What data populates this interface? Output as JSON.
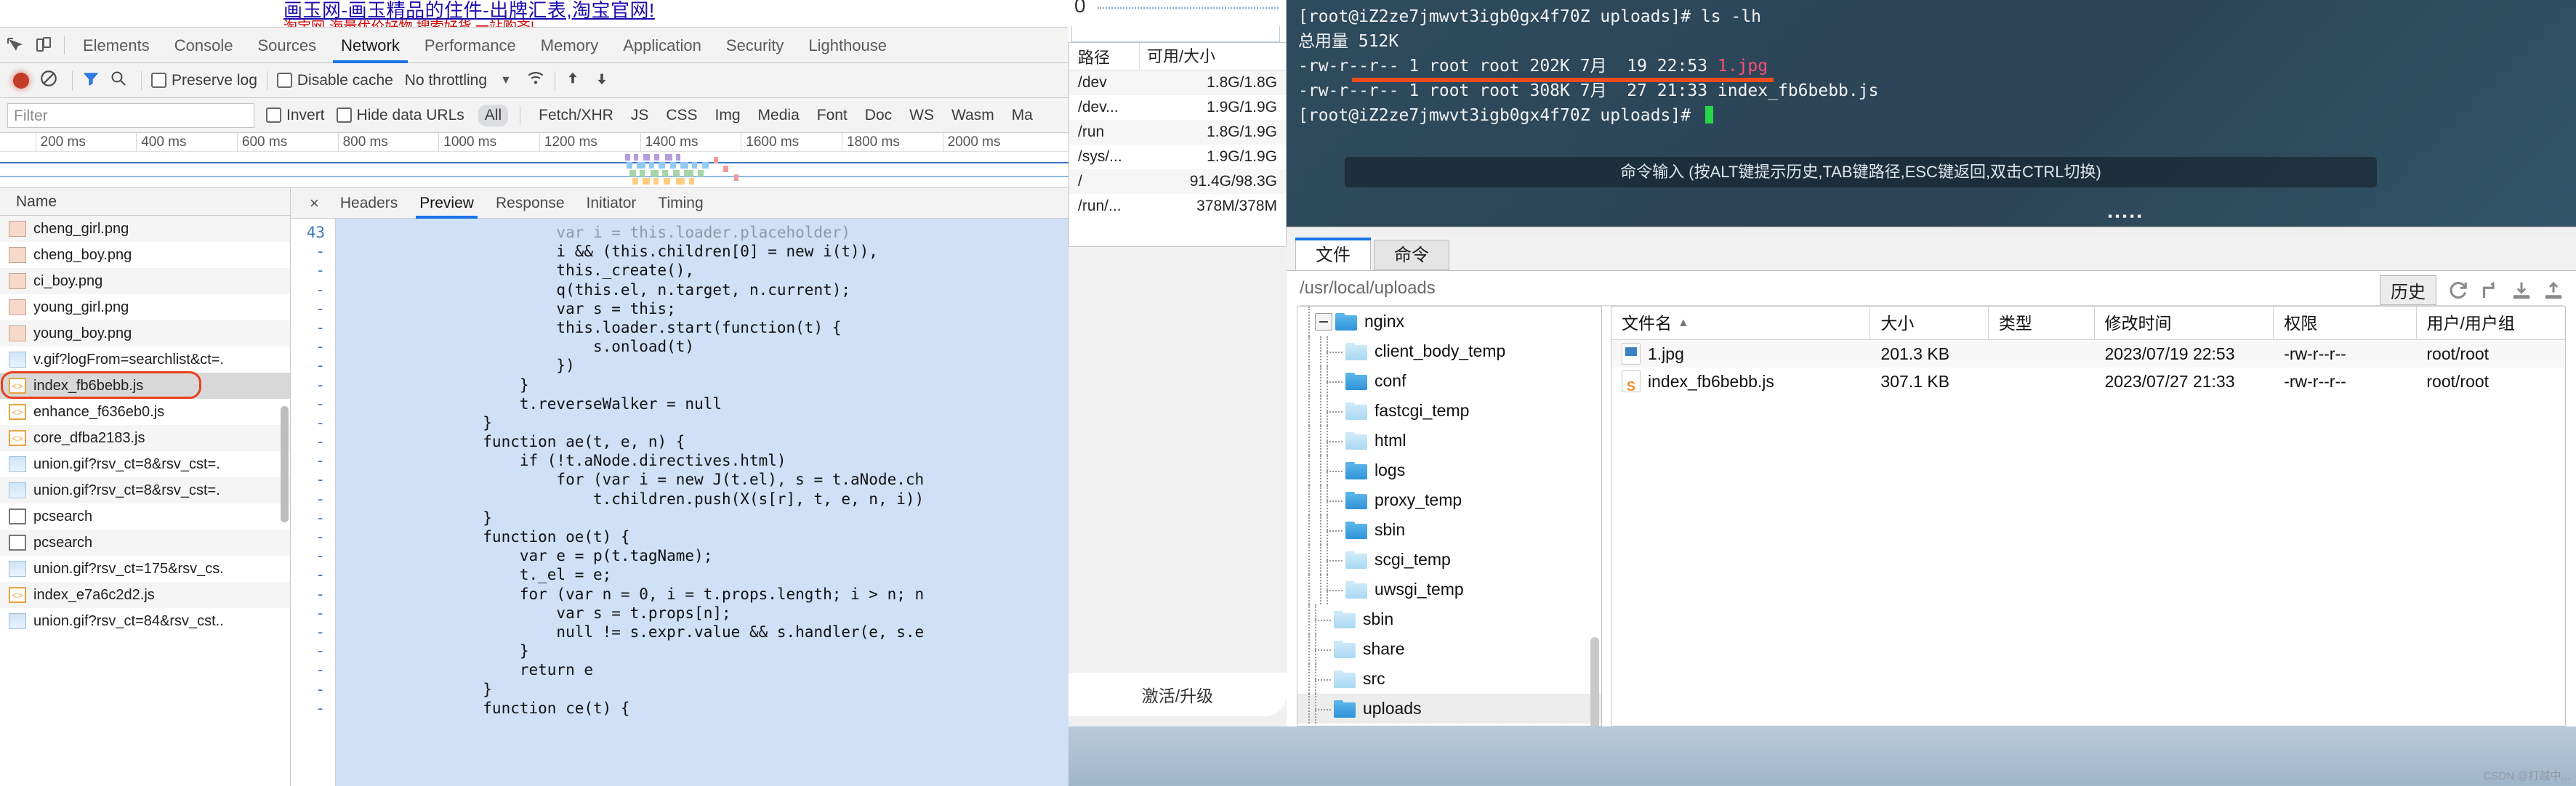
{
  "page": {
    "link_text": "画玉网-画玉精品的住件-出牌汇表,淘宝官网!",
    "sub_text": "淘宝网-海量优价好物,搜索好货,一站购齐!"
  },
  "devtools": {
    "icons": {
      "inspect": "inspect-element-icon",
      "device": "device-toolbar-icon"
    },
    "tabs": [
      "Elements",
      "Console",
      "Sources",
      "Network",
      "Performance",
      "Memory",
      "Application",
      "Security",
      "Lighthouse"
    ],
    "active_tab": "Network",
    "toolbar": {
      "record_label": "record-button",
      "clear_label": "clear-button",
      "filter_icon": "filter-icon",
      "search_icon": "search-icon",
      "preserve_log": "Preserve log",
      "disable_cache": "Disable cache",
      "throttling": "No throttling",
      "wifi_icon": "network-conditions-icon",
      "import_icon": "import-har-icon",
      "export_icon": "export-har-icon"
    },
    "filterbar": {
      "filter_placeholder": "Filter",
      "invert": "Invert",
      "hide_data_urls": "Hide data URLs",
      "types": [
        "All",
        "Fetch/XHR",
        "JS",
        "CSS",
        "Img",
        "Media",
        "Font",
        "Doc",
        "WS",
        "Wasm",
        "Ma"
      ],
      "selected_type": "All"
    },
    "timeline_ticks": [
      "200 ms",
      "400 ms",
      "600 ms",
      "800 ms",
      "1000 ms",
      "1200 ms",
      "1400 ms",
      "1600 ms",
      "1800 ms",
      "2000 ms"
    ],
    "name_header": "Name",
    "requests": [
      {
        "name": "cheng_girl.png",
        "icon": "image-file-icon",
        "kind": "face",
        "selected": false
      },
      {
        "name": "cheng_boy.png",
        "icon": "image-file-icon",
        "kind": "face",
        "selected": false
      },
      {
        "name": "ci_boy.png",
        "icon": "image-file-icon",
        "kind": "face",
        "selected": false
      },
      {
        "name": "young_girl.png",
        "icon": "image-file-icon",
        "kind": "face",
        "selected": false
      },
      {
        "name": "young_boy.png",
        "icon": "image-file-icon",
        "kind": "face",
        "selected": false
      },
      {
        "name": "v.gif?logFrom=searchlist&ct=.",
        "icon": "image-file-icon",
        "kind": "img",
        "selected": false
      },
      {
        "name": "index_fb6bebb.js",
        "icon": "script-file-icon",
        "kind": "js",
        "selected": true,
        "highlight": true
      },
      {
        "name": "enhance_f636eb0.js",
        "icon": "script-file-icon",
        "kind": "js",
        "selected": false
      },
      {
        "name": "core_dfba2183.js",
        "icon": "script-file-icon",
        "kind": "js",
        "selected": false
      },
      {
        "name": "union.gif?rsv_ct=8&rsv_cst=.",
        "icon": "image-file-icon",
        "kind": "img",
        "selected": false
      },
      {
        "name": "union.gif?rsv_ct=8&rsv_cst=.",
        "icon": "image-file-icon",
        "kind": "img",
        "selected": false
      },
      {
        "name": "pcsearch",
        "icon": "document-file-icon",
        "kind": "doc",
        "selected": false
      },
      {
        "name": "pcsearch",
        "icon": "document-file-icon",
        "kind": "doc",
        "selected": false
      },
      {
        "name": "union.gif?rsv_ct=175&rsv_cs.",
        "icon": "image-file-icon",
        "kind": "img",
        "selected": false
      },
      {
        "name": "index_e7a6c2d2.js",
        "icon": "script-file-icon",
        "kind": "js",
        "selected": false
      },
      {
        "name": "union.gif?rsv_ct=84&rsv_cst..",
        "icon": "image-file-icon",
        "kind": "img",
        "selected": false
      }
    ],
    "detail": {
      "close_label": "×",
      "tabs": [
        "Headers",
        "Preview",
        "Response",
        "Initiator",
        "Timing"
      ],
      "active_tab": "Preview",
      "line_numbers": [
        "43",
        "-",
        "-",
        "-",
        "-",
        "-",
        "-",
        "-",
        "-",
        "-",
        "-",
        "-",
        "-",
        "-",
        "-",
        "-",
        "-",
        "-",
        "-",
        "-",
        "-",
        "-",
        "-",
        "-",
        "-",
        "-"
      ],
      "code_lines": [
        "                        var i = this.loader.placeholder)",
        "                        i && (this.children[0] = new i(t)),",
        "                        this._create(),",
        "                        q(this.el, n.target, n.current);",
        "                        var s = this;",
        "                        this.loader.start(function(t) {",
        "                            s.onload(t)",
        "                        })",
        "                    }",
        "                    t.reverseWalker = null",
        "                }",
        "                function ae(t, e, n) {",
        "                    if (!t.aNode.directives.html)",
        "                        for (var i = new J(t.el), s = t.aNode.ch",
        "                            t.children.push(X(s[r], t, e, n, i))",
        "                }",
        "                function oe(t) {",
        "                    var e = p(t.tagName);",
        "                    t._el = e;",
        "                    for (var n = 0, i = t.props.length; i > n; n",
        "                        var s = t.props[n];",
        "                        null != s.expr.value && s.handler(e, s.e",
        "                    }",
        "                    return e",
        "                }",
        "                function ce(t) {"
      ]
    }
  },
  "xshell": {
    "sysinfo": {
      "zero_label": "0",
      "header": {
        "path": "路径",
        "usage": "可用/大小"
      },
      "rows": [
        {
          "path": "/dev",
          "usage": "1.8G/1.8G"
        },
        {
          "path": "/dev...",
          "usage": "1.9G/1.9G"
        },
        {
          "path": "/run",
          "usage": "1.8G/1.9G"
        },
        {
          "path": "/sys/...",
          "usage": "1.9G/1.9G"
        },
        {
          "path": "/",
          "usage": "91.4G/98.3G"
        },
        {
          "path": "/run/...",
          "usage": "378M/378M"
        }
      ]
    },
    "terminal": {
      "lines": [
        {
          "text": "[root@iZ2ze7jmwvt3igb0gx4f70Z uploads]# ls -lh"
        },
        {
          "text": "总用量 512K"
        },
        {
          "text": "-rw-r--r-- 1 root root 202K 7月  19 22:53 ",
          "suffix": "1.jpg",
          "suffix_color": "jpg"
        },
        {
          "text": "-rw-r--r-- 1 root root 308K 7月  27 21:33 index_fb6bebb.js"
        },
        {
          "text": "[root@iZ2ze7jmwvt3igb0gx4f70Z uploads]# ",
          "cursor": true
        }
      ],
      "hint": "命令输入 (按ALT键提示历史,TAB键路径,ESC键返回,双击CTRL切换)"
    },
    "file_manager": {
      "tabs": [
        "文件",
        "命令"
      ],
      "active_tab": "文件",
      "path": "/usr/local/uploads",
      "history_button": "历史",
      "tool_icons": [
        "refresh-icon",
        "parent-directory-icon",
        "download-icon",
        "upload-icon"
      ],
      "tree": [
        {
          "label": "nginx",
          "depth": 0,
          "expander": true,
          "pale": false
        },
        {
          "label": "client_body_temp",
          "depth": 1,
          "expander": false,
          "pale": true
        },
        {
          "label": "conf",
          "depth": 1,
          "expander": false,
          "pale": false
        },
        {
          "label": "fastcgi_temp",
          "depth": 1,
          "expander": false,
          "pale": true
        },
        {
          "label": "html",
          "depth": 1,
          "expander": false,
          "pale": true
        },
        {
          "label": "logs",
          "depth": 1,
          "expander": false,
          "pale": false
        },
        {
          "label": "proxy_temp",
          "depth": 1,
          "expander": false,
          "pale": false
        },
        {
          "label": "sbin",
          "depth": 1,
          "expander": false,
          "pale": false
        },
        {
          "label": "scgi_temp",
          "depth": 1,
          "expander": false,
          "pale": true
        },
        {
          "label": "uwsgi_temp",
          "depth": 1,
          "expander": false,
          "pale": true
        },
        {
          "label": "sbin",
          "depth": 0,
          "expander": false,
          "pale": true
        },
        {
          "label": "share",
          "depth": 0,
          "expander": false,
          "pale": true
        },
        {
          "label": "src",
          "depth": 0,
          "expander": false,
          "pale": true
        },
        {
          "label": "uploads",
          "depth": 0,
          "expander": false,
          "pale": false,
          "selected": true
        }
      ],
      "columns": [
        "文件名",
        "大小",
        "类型",
        "修改时间",
        "权限",
        "用户/用户组"
      ],
      "sort_column": "文件名",
      "sort_direction": "▲",
      "files": [
        {
          "name": "1.jpg",
          "size": "201.3 KB",
          "type": "",
          "modified": "2023/07/19 22:53",
          "perm": "-rw-r--r--",
          "user": "root/root",
          "icon": "jpg-file-icon"
        },
        {
          "name": "index_fb6bebb.js",
          "size": "307.1 KB",
          "type": "",
          "modified": "2023/07/27 21:33",
          "perm": "-rw-r--r--",
          "user": "root/root",
          "icon": "js-file-icon"
        }
      ]
    },
    "activate_label": "激活/升级"
  },
  "watermark": "CSDN @打越中..."
}
